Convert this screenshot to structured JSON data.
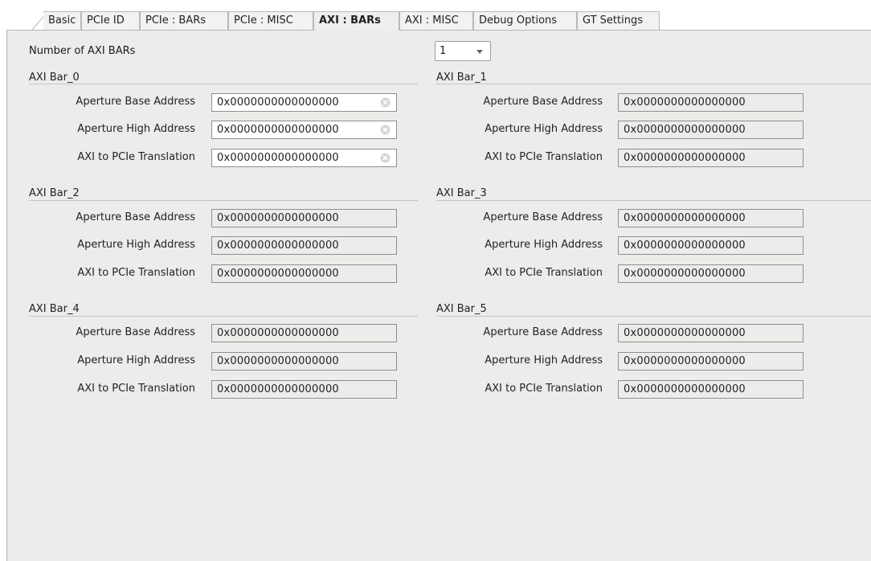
{
  "tabs": [
    {
      "label": "Basic"
    },
    {
      "label": "PCIe ID"
    },
    {
      "label": "PCIe : BARs"
    },
    {
      "label": "PCIe : MISC"
    },
    {
      "label": "AXI : BARs"
    },
    {
      "label": "AXI : MISC"
    },
    {
      "label": "Debug Options"
    },
    {
      "label": "GT Settings"
    }
  ],
  "active_tab": "AXI : BARs",
  "num_bars": {
    "label": "Number of AXI BARs",
    "value": "1"
  },
  "field_labels": {
    "base": "Aperture Base Address",
    "high": "Aperture High Address",
    "translation": "AXI to PCIe Translation"
  },
  "bars": [
    {
      "title": "AXI Bar_0",
      "enabled": true,
      "base": "0x0000000000000000",
      "high": "0x0000000000000000",
      "translation": "0x0000000000000000"
    },
    {
      "title": "AXI Bar_1",
      "enabled": false,
      "base": "0x0000000000000000",
      "high": "0x0000000000000000",
      "translation": "0x0000000000000000"
    },
    {
      "title": "AXI Bar_2",
      "enabled": false,
      "base": "0x0000000000000000",
      "high": "0x0000000000000000",
      "translation": "0x0000000000000000"
    },
    {
      "title": "AXI Bar_3",
      "enabled": false,
      "base": "0x0000000000000000",
      "high": "0x0000000000000000",
      "translation": "0x0000000000000000"
    },
    {
      "title": "AXI Bar_4",
      "enabled": false,
      "base": "0x0000000000000000",
      "high": "0x0000000000000000",
      "translation": "0x0000000000000000"
    },
    {
      "title": "AXI Bar_5",
      "enabled": false,
      "base": "0x0000000000000000",
      "high": "0x0000000000000000",
      "translation": "0x0000000000000000"
    }
  ],
  "icons": {
    "clear": "clear-circle-x-icon",
    "dropdown": "chevron-down-icon"
  }
}
